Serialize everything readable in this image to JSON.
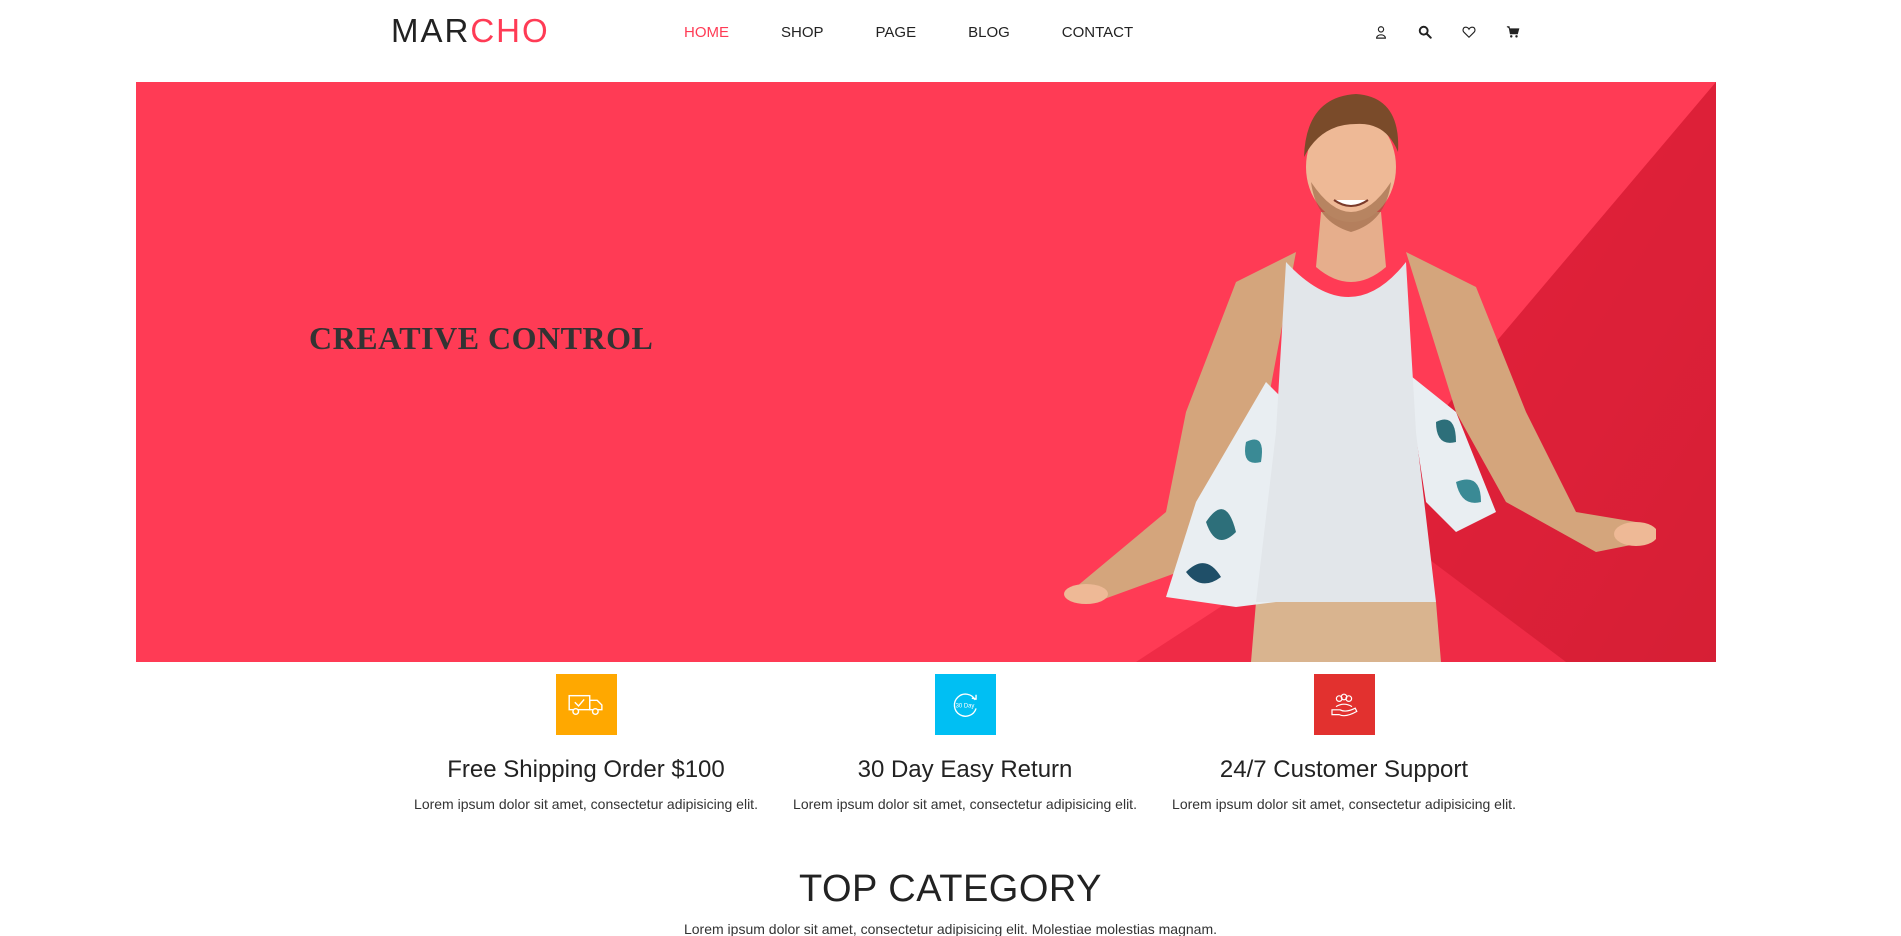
{
  "header": {
    "logo_dark": "MAR",
    "logo_accent": "CHO",
    "nav": [
      "HOME",
      "SHOP",
      "PAGE",
      "BLOG",
      "CONTACT"
    ],
    "active_nav": "HOME",
    "icons": [
      "user-icon",
      "search-icon",
      "heart-icon",
      "cart-icon"
    ]
  },
  "hero": {
    "title": "CREATIVE CONTROL",
    "background": "#ff3b55",
    "accent_dark": "#e01e3a"
  },
  "features": [
    {
      "title": "Free Shipping Order $100",
      "text": "Lorem ipsum dolor sit amet, consectetur adipisicing elit.",
      "color": "#ffa800",
      "icon": "truck-icon"
    },
    {
      "title": "30 Day Easy Return",
      "text": "Lorem ipsum dolor sit amet, consectetur adipisicing elit.",
      "color": "#00bff3",
      "icon": "return-30-icon",
      "badge": "30 Day"
    },
    {
      "title": "24/7 Customer Support",
      "text": "Lorem ipsum dolor sit amet, consectetur adipisicing elit.",
      "color": "#e2312f",
      "icon": "support-hand-icon"
    }
  ],
  "top_category": {
    "title": "TOP CATEGORY",
    "text": "Lorem ipsum dolor sit amet, consectetur adipisicing elit. Molestiae molestias magnam."
  }
}
